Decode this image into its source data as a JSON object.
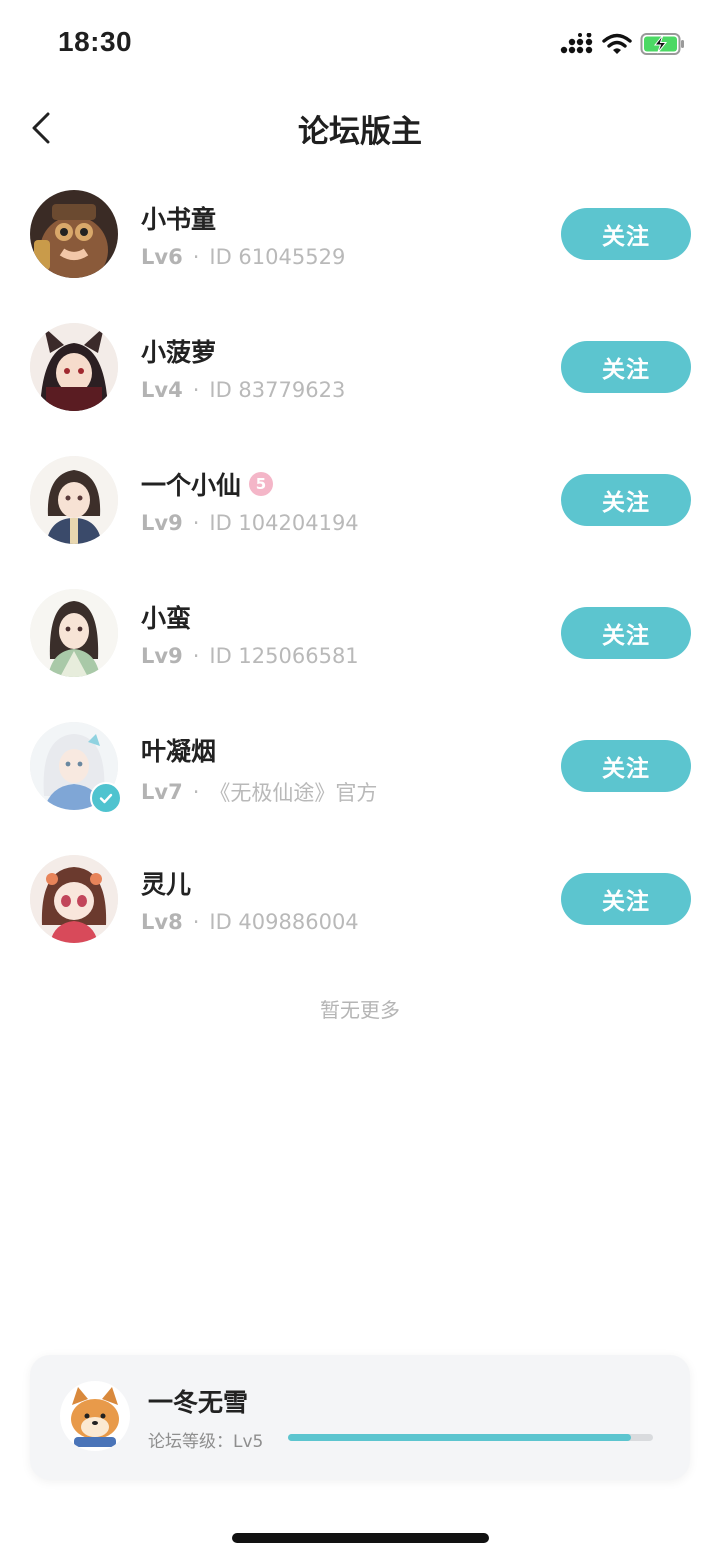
{
  "status": {
    "time": "18:30"
  },
  "header": {
    "title": "论坛版主",
    "back_icon": "chevron-left-icon"
  },
  "moderators": [
    {
      "name": "小书童",
      "level": "Lv6",
      "detail": "ID 61045529",
      "button": "关注",
      "verified": false,
      "badge": ""
    },
    {
      "name": "小菠萝",
      "level": "Lv4",
      "detail": "ID 83779623",
      "button": "关注",
      "verified": false,
      "badge": ""
    },
    {
      "name": "一个小仙",
      "level": "Lv9",
      "detail": "ID 104204194",
      "button": "关注",
      "verified": false,
      "badge": "5"
    },
    {
      "name": "小蛮",
      "level": "Lv9",
      "detail": "ID 125066581",
      "button": "关注",
      "verified": false,
      "badge": ""
    },
    {
      "name": "叶凝烟",
      "level": "Lv7",
      "detail": "《无极仙途》官方",
      "button": "关注",
      "verified": true,
      "badge": ""
    },
    {
      "name": "灵儿",
      "level": "Lv8",
      "detail": "ID 409886004",
      "button": "关注",
      "verified": false,
      "badge": ""
    }
  ],
  "list_end_text": "暂无更多",
  "current_user": {
    "name": "一冬无雪",
    "level_label": "论坛等级：Lv5",
    "progress": 0.94
  },
  "colors": {
    "accent": "#5cc5cf",
    "muted_text": "#b9b9b9",
    "card_bg": "#f4f5f7"
  }
}
